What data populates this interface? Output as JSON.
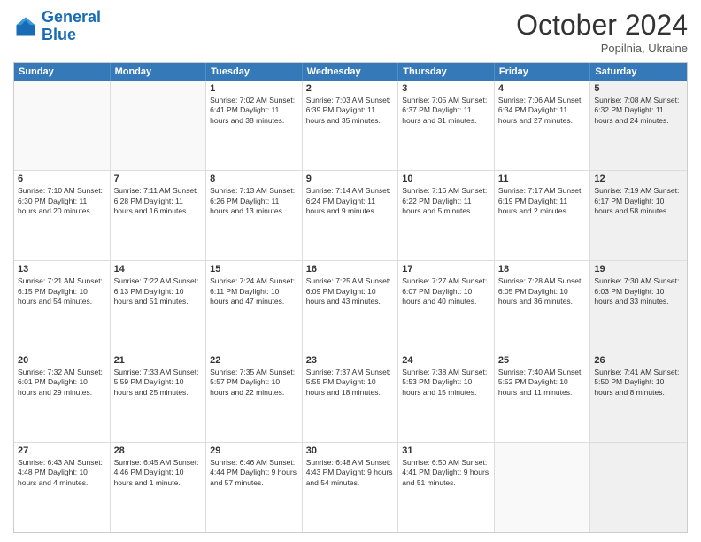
{
  "logo": {
    "line1": "General",
    "line2": "Blue"
  },
  "title": "October 2024",
  "subtitle": "Popilnia, Ukraine",
  "header_days": [
    "Sunday",
    "Monday",
    "Tuesday",
    "Wednesday",
    "Thursday",
    "Friday",
    "Saturday"
  ],
  "rows": [
    [
      {
        "day": "",
        "info": "",
        "shaded": false,
        "empty": true
      },
      {
        "day": "",
        "info": "",
        "shaded": false,
        "empty": true
      },
      {
        "day": "1",
        "info": "Sunrise: 7:02 AM\nSunset: 6:41 PM\nDaylight: 11 hours and 38 minutes.",
        "shaded": false,
        "empty": false
      },
      {
        "day": "2",
        "info": "Sunrise: 7:03 AM\nSunset: 6:39 PM\nDaylight: 11 hours and 35 minutes.",
        "shaded": false,
        "empty": false
      },
      {
        "day": "3",
        "info": "Sunrise: 7:05 AM\nSunset: 6:37 PM\nDaylight: 11 hours and 31 minutes.",
        "shaded": false,
        "empty": false
      },
      {
        "day": "4",
        "info": "Sunrise: 7:06 AM\nSunset: 6:34 PM\nDaylight: 11 hours and 27 minutes.",
        "shaded": false,
        "empty": false
      },
      {
        "day": "5",
        "info": "Sunrise: 7:08 AM\nSunset: 6:32 PM\nDaylight: 11 hours and 24 minutes.",
        "shaded": true,
        "empty": false
      }
    ],
    [
      {
        "day": "6",
        "info": "Sunrise: 7:10 AM\nSunset: 6:30 PM\nDaylight: 11 hours and 20 minutes.",
        "shaded": false,
        "empty": false
      },
      {
        "day": "7",
        "info": "Sunrise: 7:11 AM\nSunset: 6:28 PM\nDaylight: 11 hours and 16 minutes.",
        "shaded": false,
        "empty": false
      },
      {
        "day": "8",
        "info": "Sunrise: 7:13 AM\nSunset: 6:26 PM\nDaylight: 11 hours and 13 minutes.",
        "shaded": false,
        "empty": false
      },
      {
        "day": "9",
        "info": "Sunrise: 7:14 AM\nSunset: 6:24 PM\nDaylight: 11 hours and 9 minutes.",
        "shaded": false,
        "empty": false
      },
      {
        "day": "10",
        "info": "Sunrise: 7:16 AM\nSunset: 6:22 PM\nDaylight: 11 hours and 5 minutes.",
        "shaded": false,
        "empty": false
      },
      {
        "day": "11",
        "info": "Sunrise: 7:17 AM\nSunset: 6:19 PM\nDaylight: 11 hours and 2 minutes.",
        "shaded": false,
        "empty": false
      },
      {
        "day": "12",
        "info": "Sunrise: 7:19 AM\nSunset: 6:17 PM\nDaylight: 10 hours and 58 minutes.",
        "shaded": true,
        "empty": false
      }
    ],
    [
      {
        "day": "13",
        "info": "Sunrise: 7:21 AM\nSunset: 6:15 PM\nDaylight: 10 hours and 54 minutes.",
        "shaded": false,
        "empty": false
      },
      {
        "day": "14",
        "info": "Sunrise: 7:22 AM\nSunset: 6:13 PM\nDaylight: 10 hours and 51 minutes.",
        "shaded": false,
        "empty": false
      },
      {
        "day": "15",
        "info": "Sunrise: 7:24 AM\nSunset: 6:11 PM\nDaylight: 10 hours and 47 minutes.",
        "shaded": false,
        "empty": false
      },
      {
        "day": "16",
        "info": "Sunrise: 7:25 AM\nSunset: 6:09 PM\nDaylight: 10 hours and 43 minutes.",
        "shaded": false,
        "empty": false
      },
      {
        "day": "17",
        "info": "Sunrise: 7:27 AM\nSunset: 6:07 PM\nDaylight: 10 hours and 40 minutes.",
        "shaded": false,
        "empty": false
      },
      {
        "day": "18",
        "info": "Sunrise: 7:28 AM\nSunset: 6:05 PM\nDaylight: 10 hours and 36 minutes.",
        "shaded": false,
        "empty": false
      },
      {
        "day": "19",
        "info": "Sunrise: 7:30 AM\nSunset: 6:03 PM\nDaylight: 10 hours and 33 minutes.",
        "shaded": true,
        "empty": false
      }
    ],
    [
      {
        "day": "20",
        "info": "Sunrise: 7:32 AM\nSunset: 6:01 PM\nDaylight: 10 hours and 29 minutes.",
        "shaded": false,
        "empty": false
      },
      {
        "day": "21",
        "info": "Sunrise: 7:33 AM\nSunset: 5:59 PM\nDaylight: 10 hours and 25 minutes.",
        "shaded": false,
        "empty": false
      },
      {
        "day": "22",
        "info": "Sunrise: 7:35 AM\nSunset: 5:57 PM\nDaylight: 10 hours and 22 minutes.",
        "shaded": false,
        "empty": false
      },
      {
        "day": "23",
        "info": "Sunrise: 7:37 AM\nSunset: 5:55 PM\nDaylight: 10 hours and 18 minutes.",
        "shaded": false,
        "empty": false
      },
      {
        "day": "24",
        "info": "Sunrise: 7:38 AM\nSunset: 5:53 PM\nDaylight: 10 hours and 15 minutes.",
        "shaded": false,
        "empty": false
      },
      {
        "day": "25",
        "info": "Sunrise: 7:40 AM\nSunset: 5:52 PM\nDaylight: 10 hours and 11 minutes.",
        "shaded": false,
        "empty": false
      },
      {
        "day": "26",
        "info": "Sunrise: 7:41 AM\nSunset: 5:50 PM\nDaylight: 10 hours and 8 minutes.",
        "shaded": true,
        "empty": false
      }
    ],
    [
      {
        "day": "27",
        "info": "Sunrise: 6:43 AM\nSunset: 4:48 PM\nDaylight: 10 hours and 4 minutes.",
        "shaded": false,
        "empty": false
      },
      {
        "day": "28",
        "info": "Sunrise: 6:45 AM\nSunset: 4:46 PM\nDaylight: 10 hours and 1 minute.",
        "shaded": false,
        "empty": false
      },
      {
        "day": "29",
        "info": "Sunrise: 6:46 AM\nSunset: 4:44 PM\nDaylight: 9 hours and 57 minutes.",
        "shaded": false,
        "empty": false
      },
      {
        "day": "30",
        "info": "Sunrise: 6:48 AM\nSunset: 4:43 PM\nDaylight: 9 hours and 54 minutes.",
        "shaded": false,
        "empty": false
      },
      {
        "day": "31",
        "info": "Sunrise: 6:50 AM\nSunset: 4:41 PM\nDaylight: 9 hours and 51 minutes.",
        "shaded": false,
        "empty": false
      },
      {
        "day": "",
        "info": "",
        "shaded": false,
        "empty": true
      },
      {
        "day": "",
        "info": "",
        "shaded": true,
        "empty": true
      }
    ]
  ]
}
